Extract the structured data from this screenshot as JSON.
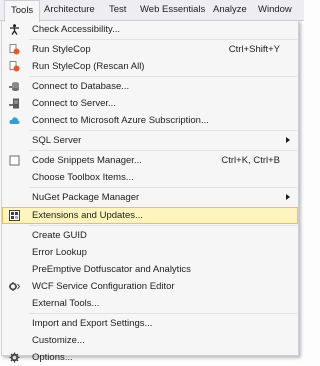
{
  "menubar": {
    "items": [
      "Tools",
      "Architecture",
      "Test",
      "Web Essentials",
      "Analyze",
      "Window"
    ]
  },
  "menu": {
    "check_accessibility": "Check Accessibility...",
    "run_stylecop": "Run StyleCop",
    "run_stylecop_shortcut": "Ctrl+Shift+Y",
    "run_stylecop_rescan": "Run StyleCop (Rescan All)",
    "connect_database": "Connect to Database...",
    "connect_server": "Connect to Server...",
    "connect_azure": "Connect to Microsoft Azure Subscription...",
    "sql_server": "SQL Server",
    "code_snippets": "Code Snippets Manager...",
    "code_snippets_shortcut": "Ctrl+K, Ctrl+B",
    "choose_toolbox": "Choose Toolbox Items...",
    "nuget": "NuGet Package Manager",
    "extensions": "Extensions and Updates...",
    "create_guid": "Create GUID",
    "error_lookup": "Error Lookup",
    "preemptive": "PreEmptive Dotfuscator and Analytics",
    "wcf_editor": "WCF Service Configuration Editor",
    "external_tools": "External Tools...",
    "import_export": "Import and Export Settings...",
    "customize": "Customize...",
    "options": "Options..."
  },
  "colors": {
    "highlight": "#fdf4bf",
    "highlight_border": "#e5c365",
    "menu_bg": "#f6f6f6",
    "separator": "#e0e3e6"
  }
}
